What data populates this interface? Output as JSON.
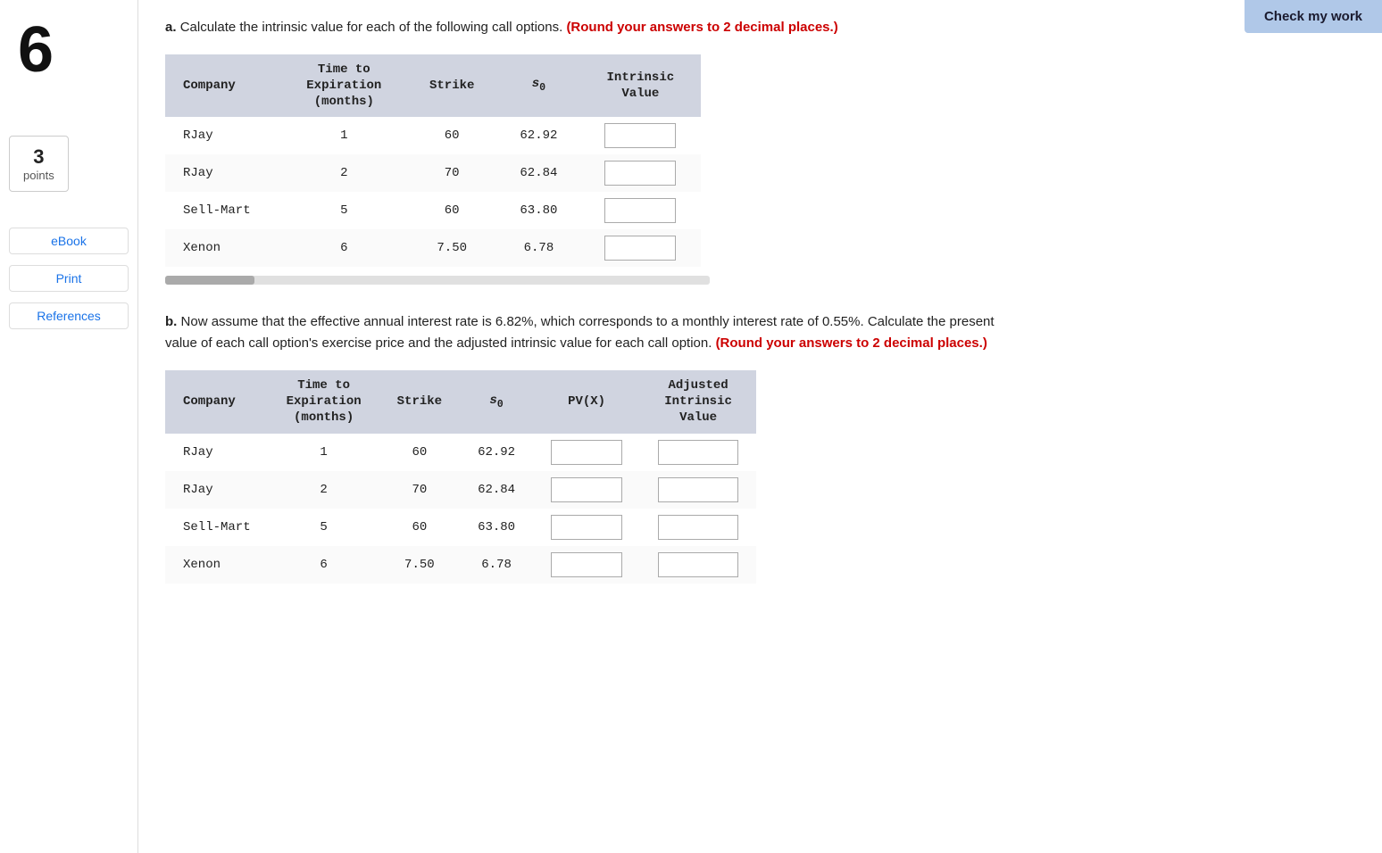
{
  "sidebar": {
    "question_number": "6",
    "points": "3",
    "points_label": "points",
    "links": [
      {
        "label": "eBook",
        "name": "ebook-link"
      },
      {
        "label": "Print",
        "name": "print-link"
      },
      {
        "label": "References",
        "name": "references-link"
      }
    ]
  },
  "header": {
    "check_button_label": "Check my work"
  },
  "part_a": {
    "label": "a.",
    "question_text": "Calculate the intrinsic value for each of the following call options.",
    "round_note": "(Round your answers to 2 decimal places.)",
    "table": {
      "headers": [
        {
          "text": "Company",
          "sub": "",
          "align": "left"
        },
        {
          "text": "Time to\nExpiration\n(months)",
          "sub": "",
          "align": "center"
        },
        {
          "text": "Strike",
          "sub": "",
          "align": "center"
        },
        {
          "text": "S",
          "sub": "0",
          "align": "center"
        },
        {
          "text": "Intrinsic\nValue",
          "sub": "",
          "align": "center"
        }
      ],
      "rows": [
        {
          "company": "RJay",
          "time": "1",
          "strike": "60",
          "s0": "62.92",
          "intrinsic": ""
        },
        {
          "company": "RJay",
          "time": "2",
          "strike": "70",
          "s0": "62.84",
          "intrinsic": ""
        },
        {
          "company": "Sell-Mart",
          "time": "5",
          "strike": "60",
          "s0": "63.80",
          "intrinsic": ""
        },
        {
          "company": "Xenon",
          "time": "6",
          "strike": "7.50",
          "s0": "6.78",
          "intrinsic": ""
        }
      ]
    }
  },
  "part_b": {
    "label": "b.",
    "question_text": "Now assume that the effective annual interest rate is 6.82%, which corresponds to a monthly interest rate of 0.55%. Calculate the present value of each call option's exercise price and the adjusted intrinsic value for each call option.",
    "round_note": "(Round your answers to 2 decimal places.)",
    "table": {
      "headers": [
        {
          "text": "Company",
          "sub": "",
          "align": "left"
        },
        {
          "text": "Time to\nExpiration\n(months)",
          "sub": "",
          "align": "center"
        },
        {
          "text": "Strike",
          "sub": "",
          "align": "center"
        },
        {
          "text": "S",
          "sub": "0",
          "align": "center"
        },
        {
          "text": "PV(X)",
          "sub": "",
          "align": "center"
        },
        {
          "text": "Adjusted\nIntrinsic\nValue",
          "sub": "",
          "align": "center"
        }
      ],
      "rows": [
        {
          "company": "RJay",
          "time": "1",
          "strike": "60",
          "s0": "62.92",
          "pv": "",
          "adj": ""
        },
        {
          "company": "RJay",
          "time": "2",
          "strike": "70",
          "s0": "62.84",
          "pv": "",
          "adj": ""
        },
        {
          "company": "Sell-Mart",
          "time": "5",
          "strike": "60",
          "s0": "63.80",
          "pv": "",
          "adj": ""
        },
        {
          "company": "Xenon",
          "time": "6",
          "strike": "7.50",
          "s0": "6.78",
          "pv": "",
          "adj": ""
        }
      ]
    }
  }
}
